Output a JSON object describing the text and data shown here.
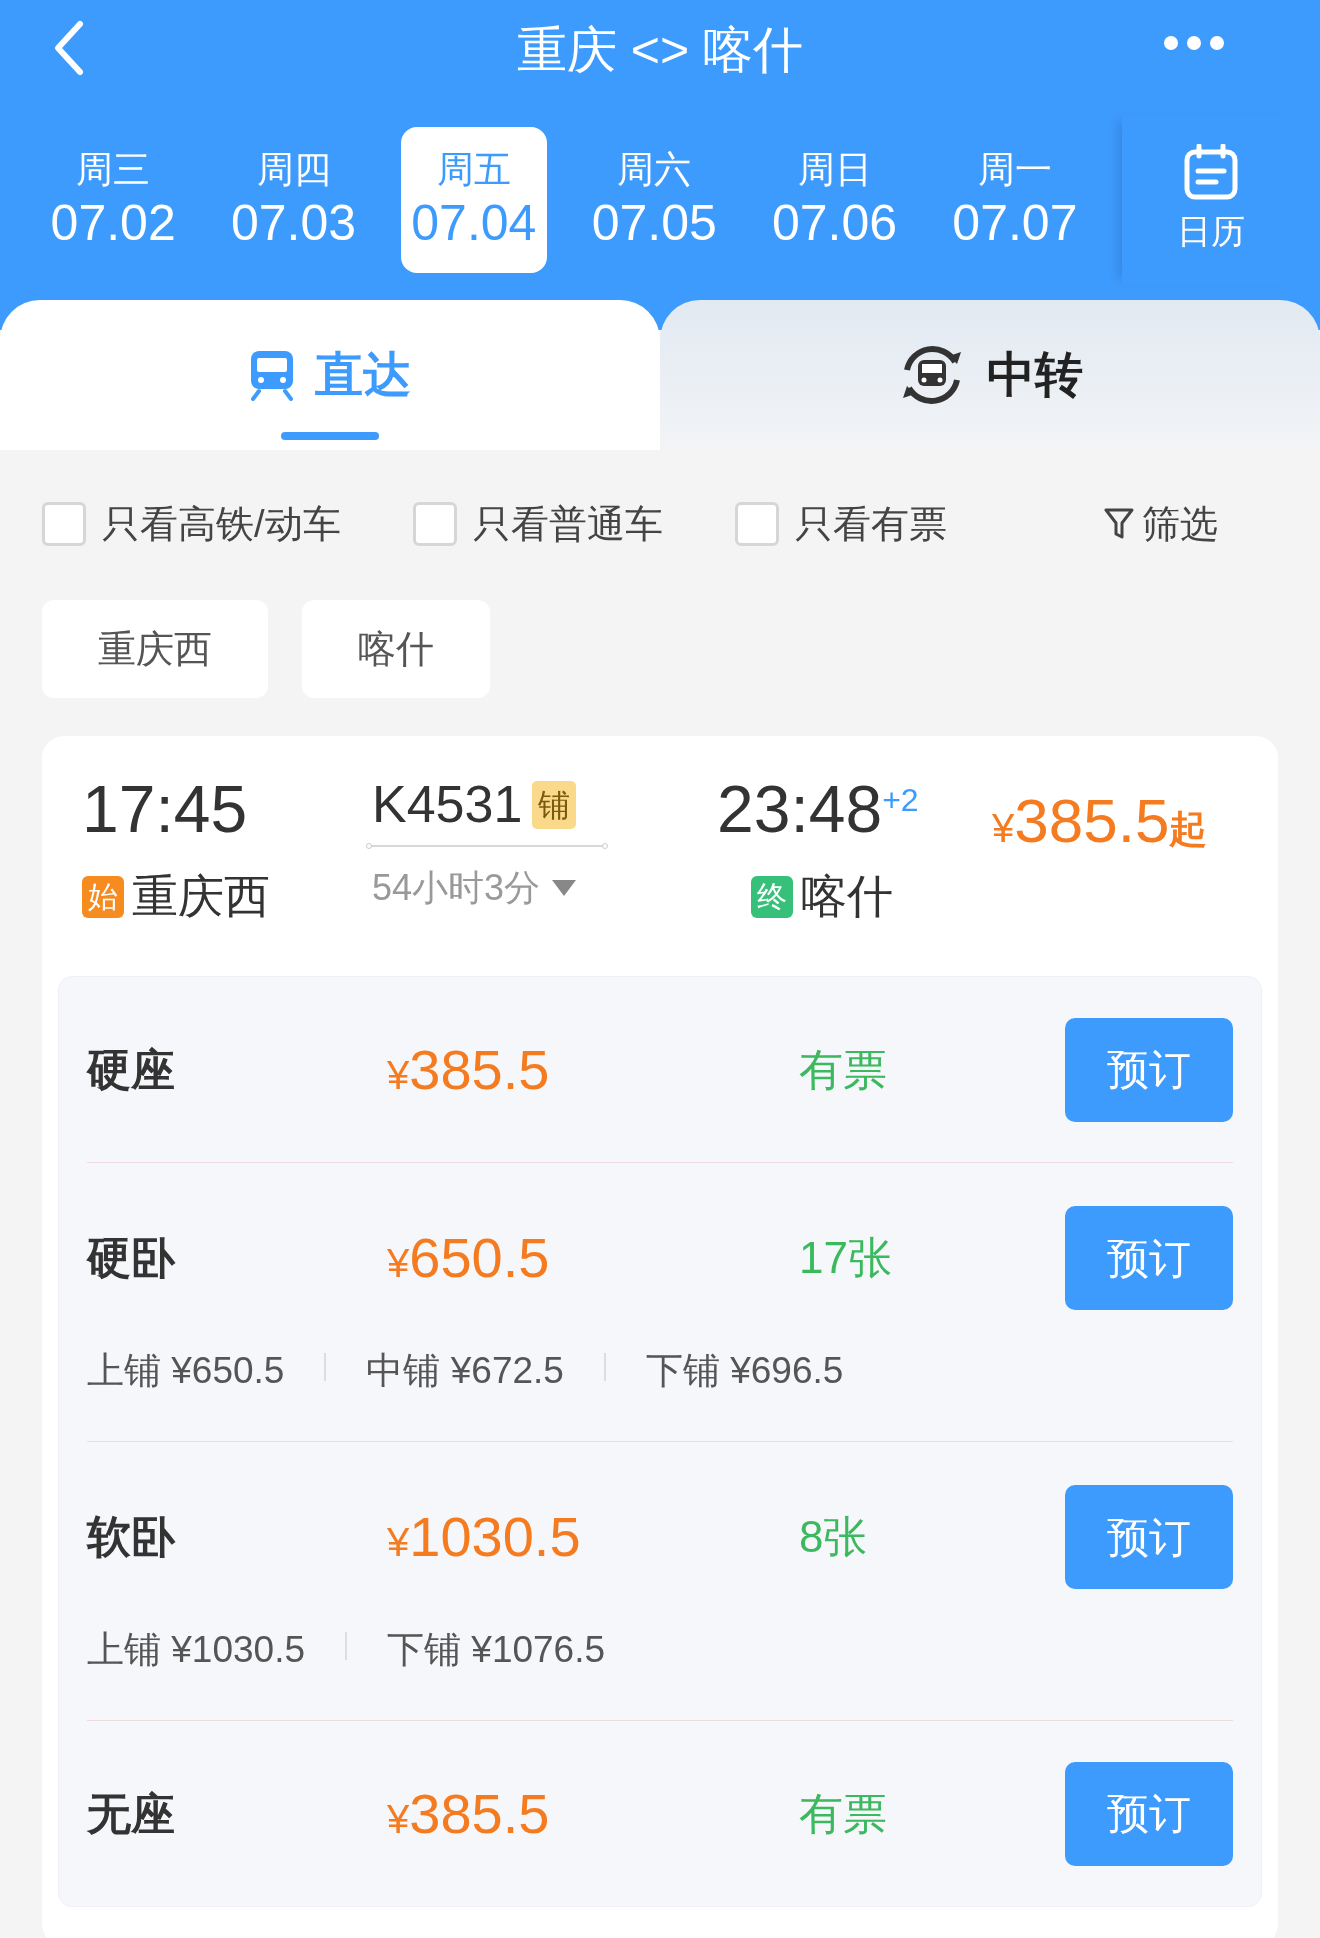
{
  "header": {
    "title": "重庆 <> 喀什"
  },
  "dates": [
    {
      "weekday": "周三",
      "date": "07.02",
      "selected": false
    },
    {
      "weekday": "周四",
      "date": "07.03",
      "selected": false
    },
    {
      "weekday": "周五",
      "date": "07.04",
      "selected": true
    },
    {
      "weekday": "周六",
      "date": "07.05",
      "selected": false
    },
    {
      "weekday": "周日",
      "date": "07.06",
      "selected": false
    },
    {
      "weekday": "周一",
      "date": "07.07",
      "selected": false
    }
  ],
  "calendar": {
    "label": "日历"
  },
  "tabs": [
    {
      "label": "直达",
      "kind": "direct",
      "selected": true
    },
    {
      "label": "中转",
      "kind": "transfer",
      "selected": false
    }
  ],
  "filters": [
    {
      "label": "只看高铁/动车",
      "checked": false
    },
    {
      "label": "只看普通车",
      "checked": false
    },
    {
      "label": "只看有票",
      "checked": false
    }
  ],
  "filter_button": {
    "label": "筛选"
  },
  "stations": [
    "重庆西",
    "喀什"
  ],
  "train": {
    "depart_time": "17:45",
    "depart_badge": "始",
    "depart_station": "重庆西",
    "number": "K4531",
    "type_badge": "铺",
    "duration": "54小时3分",
    "arrive_time": "23:48",
    "day_offset": "+2",
    "arrive_badge": "终",
    "arrive_station": "喀什",
    "currency": "¥",
    "price": "385.5",
    "price_suffix": "起",
    "seats": [
      {
        "name": "硬座",
        "currency": "¥",
        "price": "385.5",
        "availability": "有票",
        "button": "预订"
      },
      {
        "name": "硬卧",
        "currency": "¥",
        "price": "650.5",
        "availability": "17张",
        "button": "预订",
        "berths": [
          "上铺 ¥650.5",
          "中铺 ¥672.5",
          "下铺 ¥696.5"
        ]
      },
      {
        "name": "软卧",
        "currency": "¥",
        "price": "1030.5",
        "availability": "8张",
        "button": "预订",
        "berths": [
          "上铺 ¥1030.5",
          "下铺 ¥1076.5"
        ]
      },
      {
        "name": "无座",
        "currency": "¥",
        "price": "385.5",
        "availability": "有票",
        "button": "预订"
      }
    ]
  }
}
